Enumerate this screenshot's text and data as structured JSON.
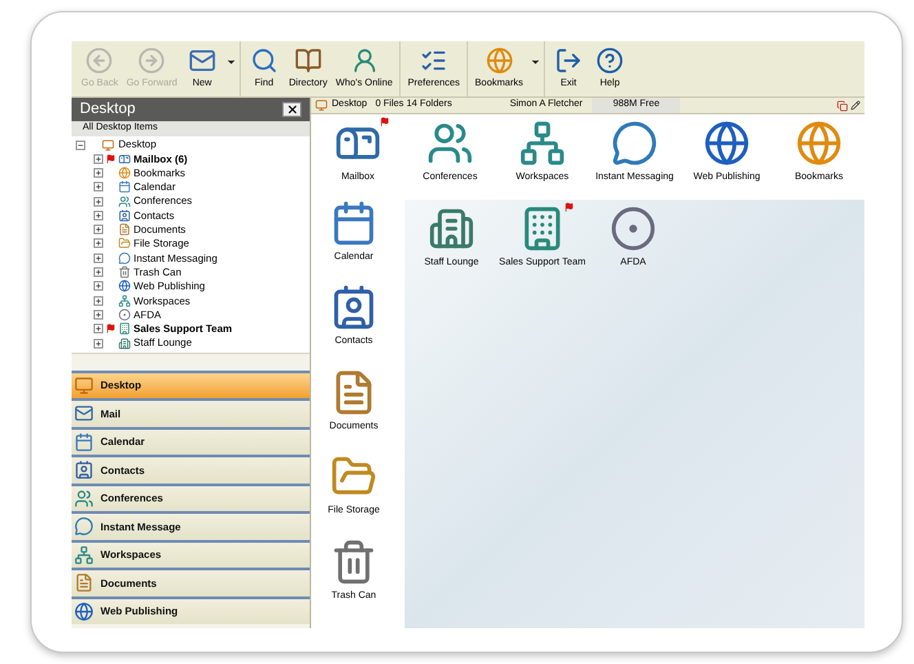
{
  "toolbar": {
    "groups": [
      [
        {
          "label": "Go Back",
          "kind": "back",
          "disabled": true,
          "dropdown": false
        },
        {
          "label": "Go Forward",
          "kind": "forward",
          "disabled": true,
          "dropdown": false
        },
        {
          "label": "New",
          "kind": "new",
          "disabled": false,
          "dropdown": true
        }
      ],
      [
        {
          "label": "Find",
          "kind": "find",
          "disabled": false,
          "dropdown": false
        },
        {
          "label": "Directory",
          "kind": "directory",
          "disabled": false,
          "dropdown": false
        },
        {
          "label": "Who's Online",
          "kind": "online",
          "disabled": false,
          "dropdown": false
        }
      ],
      [
        {
          "label": "Preferences",
          "kind": "preferences",
          "disabled": false,
          "dropdown": false
        }
      ],
      [
        {
          "label": "Bookmarks",
          "kind": "bookmarks",
          "disabled": false,
          "dropdown": true
        }
      ],
      [
        {
          "label": "Exit",
          "kind": "exit",
          "disabled": false,
          "dropdown": false
        },
        {
          "label": "Help",
          "kind": "help",
          "disabled": false,
          "dropdown": false
        }
      ]
    ]
  },
  "sidebar": {
    "title": "Desktop",
    "subtitle": "All Desktop Items",
    "tree": {
      "label": "Desktop",
      "kind": "desktop",
      "expanded": true,
      "children": [
        {
          "label": "Mailbox (6)",
          "kind": "mailbox",
          "bold": true,
          "flagged": true
        },
        {
          "label": "Bookmarks",
          "kind": "bookmarks",
          "bold": false,
          "flagged": false
        },
        {
          "label": "Calendar",
          "kind": "calendar",
          "bold": false,
          "flagged": false
        },
        {
          "label": "Conferences",
          "kind": "conferences",
          "bold": false,
          "flagged": false
        },
        {
          "label": "Contacts",
          "kind": "contacts",
          "bold": false,
          "flagged": false
        },
        {
          "label": "Documents",
          "kind": "documents",
          "bold": false,
          "flagged": false
        },
        {
          "label": "File Storage",
          "kind": "files",
          "bold": false,
          "flagged": false
        },
        {
          "label": "Instant Messaging",
          "kind": "messaging",
          "bold": false,
          "flagged": false
        },
        {
          "label": "Trash Can",
          "kind": "trash",
          "bold": false,
          "flagged": false
        },
        {
          "label": "Web Publishing",
          "kind": "web",
          "bold": false,
          "flagged": false
        },
        {
          "label": "Workspaces",
          "kind": "workspaces",
          "bold": false,
          "flagged": false
        },
        {
          "label": "AFDA",
          "kind": "afda",
          "bold": false,
          "flagged": false
        },
        {
          "label": "Sales Support Team",
          "kind": "team",
          "bold": true,
          "flagged": true
        },
        {
          "label": "Staff Lounge",
          "kind": "lounge",
          "bold": false,
          "flagged": false
        }
      ]
    },
    "nav": [
      {
        "label": "Desktop",
        "kind": "desktop",
        "selected": true
      },
      {
        "label": "Mail",
        "kind": "mail",
        "selected": false
      },
      {
        "label": "Calendar",
        "kind": "calendar",
        "selected": false
      },
      {
        "label": "Contacts",
        "kind": "contacts",
        "selected": false
      },
      {
        "label": "Conferences",
        "kind": "conferences",
        "selected": false
      },
      {
        "label": "Instant Message",
        "kind": "messaging",
        "selected": false
      },
      {
        "label": "Workspaces",
        "kind": "workspaces",
        "selected": false
      },
      {
        "label": "Documents",
        "kind": "documents",
        "selected": false
      },
      {
        "label": "Web Publishing",
        "kind": "web",
        "selected": false
      }
    ]
  },
  "status_bar": {
    "location": "Desktop",
    "counts": "0 Files 14 Folders",
    "user": "Simon A Fletcher",
    "free_space": "988M Free"
  },
  "top_icons": [
    {
      "label": "Mailbox",
      "kind": "mailbox",
      "flagged": true
    },
    {
      "label": "Conferences",
      "kind": "conferences",
      "flagged": false
    },
    {
      "label": "Workspaces",
      "kind": "workspaces",
      "flagged": false
    },
    {
      "label": "Instant Messaging",
      "kind": "messaging",
      "flagged": false
    },
    {
      "label": "Web Publishing",
      "kind": "web",
      "flagged": false
    },
    {
      "label": "Bookmarks",
      "kind": "bookmarks",
      "flagged": false
    }
  ],
  "side_icons": [
    {
      "label": "Calendar",
      "kind": "calendar"
    },
    {
      "label": "Contacts",
      "kind": "contacts"
    },
    {
      "label": "Documents",
      "kind": "documents"
    },
    {
      "label": "File Storage",
      "kind": "files"
    },
    {
      "label": "Trash Can",
      "kind": "trash"
    }
  ],
  "content_icons": [
    {
      "label": "Staff Lounge",
      "kind": "lounge",
      "flagged": false
    },
    {
      "label": "Sales Support Team",
      "kind": "team",
      "flagged": true
    },
    {
      "label": "AFDA",
      "kind": "afda",
      "flagged": false
    }
  ]
}
